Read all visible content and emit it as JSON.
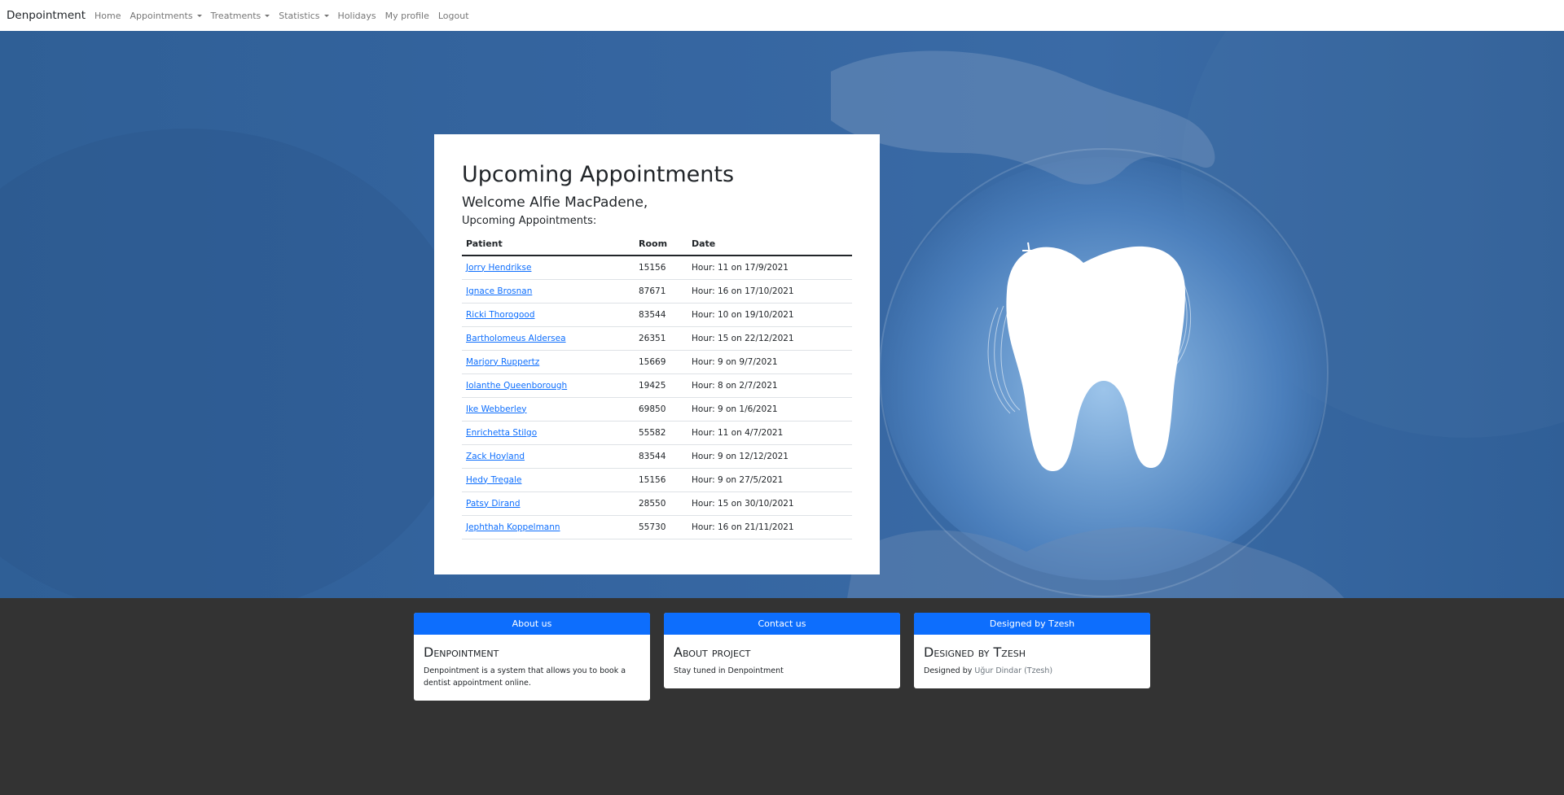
{
  "navbar": {
    "brand": "Denpointment",
    "items": [
      {
        "label": "Home",
        "dropdown": false
      },
      {
        "label": "Appointments",
        "dropdown": true
      },
      {
        "label": "Treatments",
        "dropdown": true
      },
      {
        "label": "Statistics",
        "dropdown": true
      },
      {
        "label": "Holidays",
        "dropdown": false
      },
      {
        "label": "My profile",
        "dropdown": false
      },
      {
        "label": "Logout",
        "dropdown": false
      }
    ]
  },
  "hero": {
    "image": "tooth-in-hands-icon",
    "colors": {
      "background": "#3565a0",
      "glow": "#9cc4ea"
    }
  },
  "appointments": {
    "title": "Upcoming Appointments",
    "welcome": "Welcome Alfie MacPadene,",
    "subheading": "Upcoming Appointments:",
    "columns": [
      "Patient",
      "Room",
      "Date"
    ],
    "rows": [
      {
        "patient": "Jorry Hendrikse",
        "room": "15156",
        "date": "Hour: 11 on 17/9/2021"
      },
      {
        "patient": "Ignace Brosnan",
        "room": "87671",
        "date": "Hour: 16 on 17/10/2021"
      },
      {
        "patient": "Ricki Thorogood",
        "room": "83544",
        "date": "Hour: 10 on 19/10/2021"
      },
      {
        "patient": "Bartholomeus Aldersea",
        "room": "26351",
        "date": "Hour: 15 on 22/12/2021"
      },
      {
        "patient": "Marjory Ruppertz",
        "room": "15669",
        "date": "Hour: 9 on 9/7/2021"
      },
      {
        "patient": "Iolanthe Queenborough",
        "room": "19425",
        "date": "Hour: 8 on 2/7/2021"
      },
      {
        "patient": "Ike Webberley",
        "room": "69850",
        "date": "Hour: 9 on 1/6/2021"
      },
      {
        "patient": "Enrichetta Stilgo",
        "room": "55582",
        "date": "Hour: 11 on 4/7/2021"
      },
      {
        "patient": "Zack Hoyland",
        "room": "83544",
        "date": "Hour: 9 on 12/12/2021"
      },
      {
        "patient": "Hedy Tregale",
        "room": "15156",
        "date": "Hour: 9 on 27/5/2021"
      },
      {
        "patient": "Patsy Dirand",
        "room": "28550",
        "date": "Hour: 15 on 30/10/2021"
      },
      {
        "patient": "Jephthah Koppelmann",
        "room": "55730",
        "date": "Hour: 16 on 21/11/2021"
      }
    ]
  },
  "footer": {
    "colors": {
      "header": "#0d6efd",
      "background": "#333333"
    },
    "cards": {
      "about": {
        "header": "About us",
        "title": "Denpointment",
        "text": "Denpointment is a system that allows you to book a dentist appointment online."
      },
      "contact": {
        "header": "Contact us",
        "title": "About project",
        "text": "Stay tuned in Denpointment"
      },
      "designed": {
        "header": "Designed by Tzesh",
        "title": "Designed by Tzesh",
        "text_prefix": "Designed by",
        "author": "Uğur Dindar (Tzesh)"
      }
    }
  }
}
